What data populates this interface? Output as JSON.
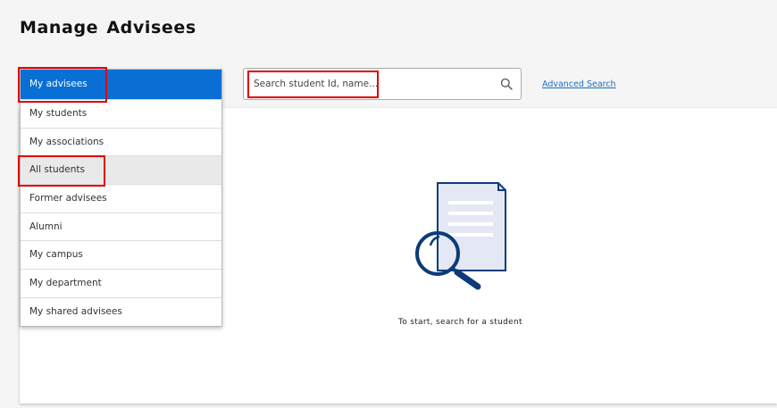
{
  "page": {
    "title": "Manage Advisees"
  },
  "dropdown": {
    "selected": "My advisees",
    "options": [
      "My advisees",
      "My students",
      "My associations",
      "All students",
      "Former advisees",
      "Alumni",
      "My campus",
      "My department",
      "My shared advisees"
    ]
  },
  "search": {
    "placeholder": "Search student Id, name...",
    "value": ""
  },
  "advanced_search": {
    "label": "Advanced Search"
  },
  "empty_state": {
    "message": "To start, search for a student",
    "icon": "document-search-icon"
  },
  "colors": {
    "accent": "#0a6fd4",
    "icon_navy": "#0d3b7a",
    "highlight": "#e00000"
  }
}
